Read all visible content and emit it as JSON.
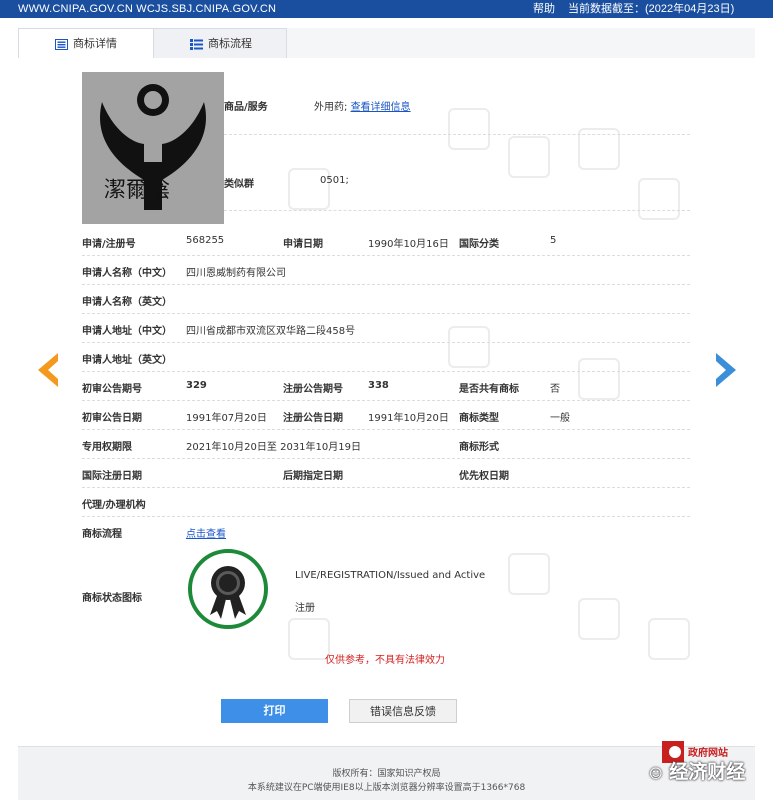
{
  "topbar": {
    "url": "WWW.CNIPA.GOV.CN WCJS.SBJ.CNIPA.GOV.CN",
    "help": "帮助",
    "as_of": "当前数据截至：(2022年04月23日)"
  },
  "tabs": [
    {
      "label": "商标详情",
      "active": true,
      "icon": "list-doc-icon"
    },
    {
      "label": "商标流程",
      "active": false,
      "icon": "flow-list-icon"
    }
  ],
  "logo": {
    "text": "潔爾陰"
  },
  "goods": {
    "label": "商品/服务",
    "value": "外用药;",
    "link": "查看详细信息"
  },
  "similar_group": {
    "label": "类似群",
    "value": "0501;"
  },
  "fields": {
    "reg_no": {
      "label": "申请/注册号",
      "value": "568255"
    },
    "app_date": {
      "label": "申请日期",
      "value": "1990年10月16日"
    },
    "intl_class": {
      "label": "国际分类",
      "value": "5"
    },
    "applicant_cn": {
      "label": "申请人名称（中文）",
      "value": "四川恩威制药有限公司"
    },
    "applicant_en": {
      "label": "申请人名称（英文）",
      "value": ""
    },
    "address_cn": {
      "label": "申请人地址（中文）",
      "value": "四川省成都市双流区双华路二段458号"
    },
    "address_en": {
      "label": "申请人地址（英文）",
      "value": ""
    },
    "prelim_no": {
      "label": "初审公告期号",
      "value": "329"
    },
    "reg_pub_no": {
      "label": "注册公告期号",
      "value": "338"
    },
    "shared": {
      "label": "是否共有商标",
      "value": "否"
    },
    "prelim_date": {
      "label": "初审公告日期",
      "value": "1991年07月20日"
    },
    "reg_pub_date": {
      "label": "注册公告日期",
      "value": "1991年10月20日"
    },
    "mark_type": {
      "label": "商标类型",
      "value": "一般"
    },
    "exclusive_period": {
      "label": "专用权期限",
      "value": "2021年10月20日至 2031年10月19日"
    },
    "mark_form": {
      "label": "商标形式",
      "value": ""
    },
    "intl_reg_date": {
      "label": "国际注册日期",
      "value": ""
    },
    "later_designation": {
      "label": "后期指定日期",
      "value": ""
    },
    "priority_date": {
      "label": "优先权日期",
      "value": ""
    },
    "agency": {
      "label": "代理/办理机构",
      "value": ""
    },
    "flow": {
      "label": "商标流程",
      "link": "点击查看"
    },
    "status_icon": {
      "label": "商标状态图标",
      "status_en": "LIVE/REGISTRATION/Issued and Active",
      "status_cn": "注册"
    }
  },
  "disclaimer": "仅供参考，不具有法律效力",
  "buttons": {
    "print": "打印",
    "feedback": "错误信息反馈"
  },
  "footer": {
    "copyright": "版权所有：国家知识产权局",
    "browser_tip": "本系统建议在PC端使用IE8以上版本浏览器分辨率设置高于1366*768"
  },
  "overlays": {
    "gov_badge": "政府网站",
    "watermark": "经济财经"
  },
  "colors": {
    "topbar": "#1a4fa0",
    "link": "#1a55c6",
    "print_button": "#3d8fe8",
    "status_ring": "#1d8a3a",
    "prev_arrow": "#f39a1e",
    "next_arrow": "#3a8fd8",
    "disclaimer": "#d42020"
  }
}
